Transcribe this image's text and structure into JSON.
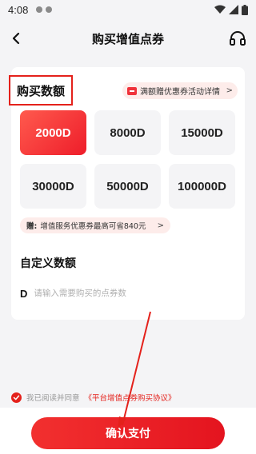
{
  "status_bar": {
    "time": "4:08"
  },
  "header": {
    "title": "购买增值点券"
  },
  "purchase": {
    "section_title": "购买数额",
    "promo_label": "满额赠优惠券活动详情",
    "amounts": [
      {
        "label": "2000D",
        "selected": true
      },
      {
        "label": "8000D",
        "selected": false
      },
      {
        "label": "15000D",
        "selected": false
      },
      {
        "label": "30000D",
        "selected": false
      },
      {
        "label": "50000D",
        "selected": false
      },
      {
        "label": "100000D",
        "selected": false
      }
    ],
    "bonus_tag": "赠:",
    "bonus_text": "增值服务优惠券最高可省840元"
  },
  "custom": {
    "title": "自定义数额",
    "currency_letter": "D",
    "input_value": "",
    "input_placeholder": "请输入需要购买的点券数"
  },
  "agreement": {
    "prefix": "我已阅读并同意",
    "link": "《平台增值点券购买协议》",
    "checked": true
  },
  "footer": {
    "pay_button": "确认支付"
  },
  "colors": {
    "accent": "#e4211b",
    "pill_bg": "#fdecea",
    "tile_bg": "#f4f4f6"
  },
  "icons": {
    "back": "chevron-left-icon",
    "service": "headset-icon",
    "promo": "ticket-icon",
    "check": "check-circle-icon"
  }
}
